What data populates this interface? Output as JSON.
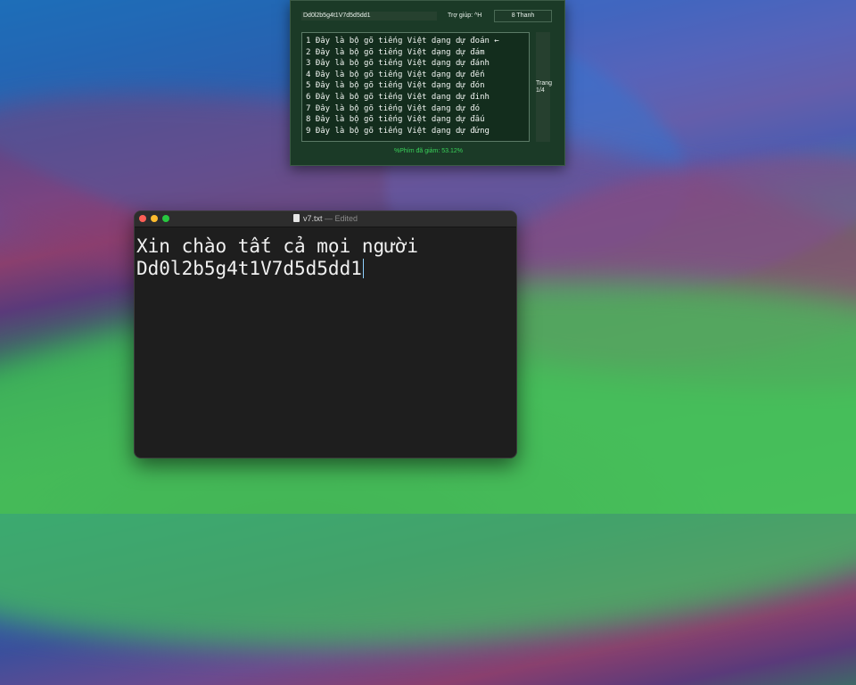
{
  "ime": {
    "input": "Dd0l2b5g4t1V7d5d5dd1",
    "help": "Trợ giúp: ^H",
    "user": "8 Thanh",
    "candidates": [
      "1 Đây là bộ gõ tiếng Việt dạng dự đoán ←",
      "2 Đây là bộ gõ tiếng Việt dạng dự đám",
      "3 Đây là bộ gõ tiếng Việt dạng dự đánh",
      "4 Đây là bộ gõ tiếng Việt dạng dự đến",
      "5 Đây là bộ gõ tiếng Việt dạng dự đón",
      "6 Đây là bộ gõ tiếng Việt dạng dự đinh",
      "7 Đây là bộ gõ tiếng Việt dạng dự đó",
      "8 Đây là bộ gõ tiếng Việt dạng dự đấu",
      "9 Đây là bộ gõ tiếng Việt dạng dự đứng"
    ],
    "page_label": "Trang",
    "page_value": "1/4",
    "stat": "%Phím đã giảm: 53.12%"
  },
  "editor": {
    "filename": "v7.txt",
    "separator": "—",
    "status": "Edited",
    "line1": "Xin chào tất cả mọi người",
    "line2": "Dd0l2b5g4t1V7d5d5dd1"
  },
  "colors": {
    "ime_bg": "#1b3a27",
    "stat_green": "#3ad15a",
    "close": "#ff5f57",
    "minimize": "#febc2e",
    "maximize": "#28c840"
  }
}
